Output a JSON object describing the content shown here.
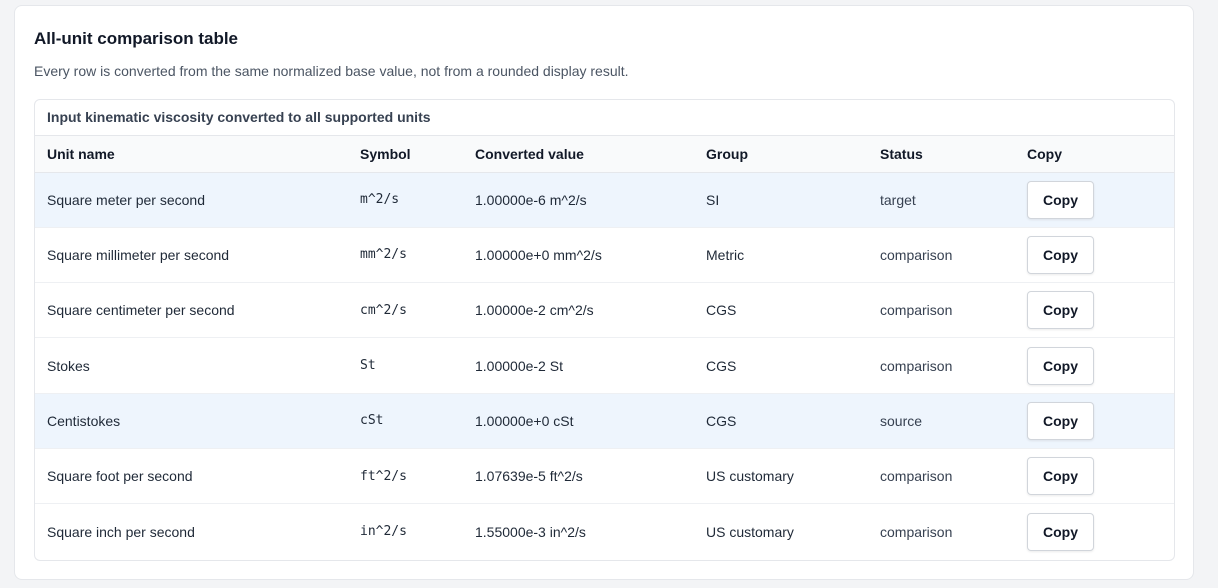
{
  "section": {
    "title": "All-unit comparison table",
    "description": "Every row is converted from the same normalized base value, not from a rounded display result."
  },
  "table": {
    "caption": "Input kinematic viscosity converted to all supported units",
    "headers": [
      "Unit name",
      "Symbol",
      "Converted value",
      "Group",
      "Status",
      "Copy"
    ],
    "rows": [
      {
        "name": "Square meter per second",
        "symbol": "m^2/s",
        "value": "1.00000e-6 m^2/s",
        "group": "SI",
        "status": "target",
        "copy": "Copy"
      },
      {
        "name": "Square millimeter per second",
        "symbol": "mm^2/s",
        "value": "1.00000e+0 mm^2/s",
        "group": "Metric",
        "status": "comparison",
        "copy": "Copy"
      },
      {
        "name": "Square centimeter per second",
        "symbol": "cm^2/s",
        "value": "1.00000e-2 cm^2/s",
        "group": "CGS",
        "status": "comparison",
        "copy": "Copy"
      },
      {
        "name": "Stokes",
        "symbol": "St",
        "value": "1.00000e-2 St",
        "group": "CGS",
        "status": "comparison",
        "copy": "Copy"
      },
      {
        "name": "Centistokes",
        "symbol": "cSt",
        "value": "1.00000e+0 cSt",
        "group": "CGS",
        "status": "source",
        "copy": "Copy"
      },
      {
        "name": "Square foot per second",
        "symbol": "ft^2/s",
        "value": "1.07639e-5 ft^2/s",
        "group": "US customary",
        "status": "comparison",
        "copy": "Copy"
      },
      {
        "name": "Square inch per second",
        "symbol": "in^2/s",
        "value": "1.55000e-3 in^2/s",
        "group": "US customary",
        "status": "comparison",
        "copy": "Copy"
      }
    ]
  },
  "colors": {
    "highlight_row": "#eef5fd",
    "border": "#e5e7eb"
  }
}
